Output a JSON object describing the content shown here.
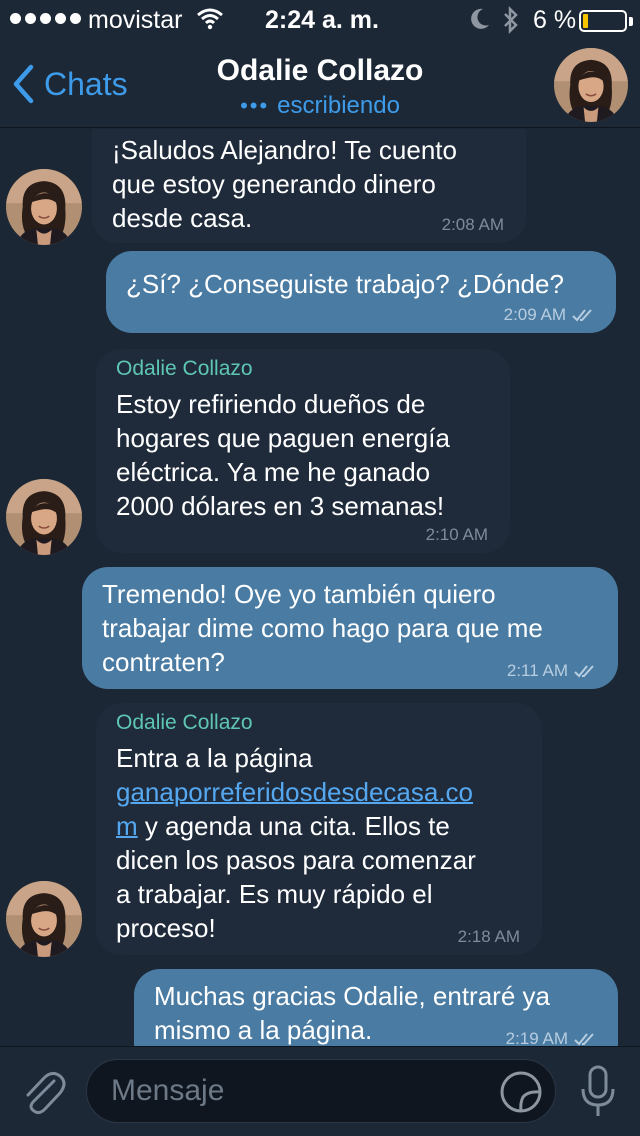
{
  "status_bar": {
    "carrier": "movistar",
    "time": "2:24 a. m.",
    "battery_percent": "6 %",
    "battery_level": 0.06
  },
  "nav": {
    "back_label": "Chats",
    "title": "Odalie Collazo",
    "status": "escribiendo",
    "typing_dots": "•••"
  },
  "messages": [
    {
      "direction": "incoming",
      "lines": [
        "¡Saludos Alejandro! Te cuento",
        "que estoy generando dinero",
        "desde casa."
      ],
      "time": "2:08 AM"
    },
    {
      "direction": "outgoing",
      "lines": [
        "¿Sí? ¿Conseguiste trabajo? ¿Dónde?"
      ],
      "time": "2:09 AM"
    },
    {
      "direction": "incoming",
      "sender": "Odalie Collazo",
      "lines": [
        "Estoy refiriendo dueños de",
        "hogares que paguen energía",
        "eléctrica. Ya me he ganado",
        "2000 dólares en 3 semanas!"
      ],
      "time": "2:10 AM"
    },
    {
      "direction": "outgoing",
      "lines": [
        "Tremendo! Oye yo también quiero",
        "trabajar dime como hago para que me",
        "contraten?"
      ],
      "time": "2:11 AM"
    },
    {
      "direction": "incoming",
      "sender": "Odalie Collazo",
      "line1": "Entra a la página",
      "link_part1": "ganaporreferidosdesdecasa.co",
      "link_part2": "m",
      "line3_rest": " y agenda una cita. Ellos te",
      "line4": "dicen los pasos para comenzar",
      "line5": "a trabajar. Es muy rápido el",
      "line6": "proceso!",
      "time": "2:18 AM"
    },
    {
      "direction": "outgoing",
      "lines": [
        "Muchas gracias Odalie, entraré ya",
        "mismo a la página."
      ],
      "time": "2:19 AM"
    }
  ],
  "input": {
    "placeholder": "Mensaje"
  },
  "colors": {
    "background": "#1c2735",
    "incoming_bubble": "#1f2b3b",
    "outgoing_bubble": "#4a7ba3",
    "accent": "#3d9be9",
    "sender_name": "#5ec7b3",
    "battery_low": "#f6c500"
  },
  "icons": [
    "wifi-icon",
    "moon-icon",
    "bluetooth-icon",
    "battery-icon",
    "chevron-left-icon",
    "double-check-icon",
    "paperclip-icon",
    "sticker-icon",
    "microphone-icon"
  ]
}
